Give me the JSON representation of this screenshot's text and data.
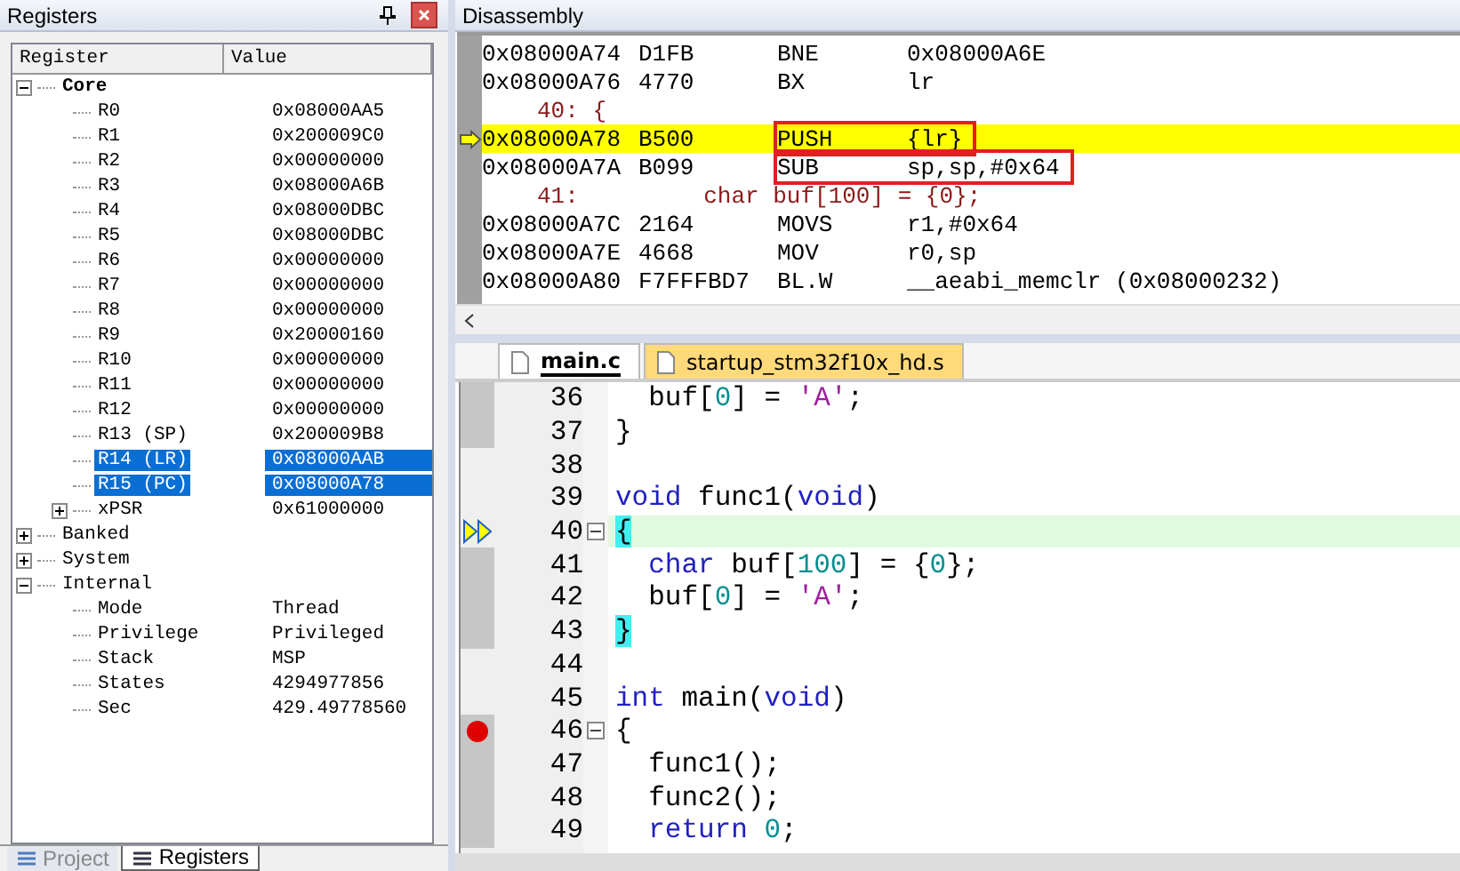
{
  "registers": {
    "title": "Registers",
    "columns": [
      "Register",
      "Value"
    ],
    "tree": [
      {
        "name": "Core",
        "bold": true,
        "expanded": true,
        "selected": false,
        "children": [
          {
            "name": "R0",
            "value": "0x08000AA5",
            "selected": false
          },
          {
            "name": "R1",
            "value": "0x200009C0",
            "selected": false
          },
          {
            "name": "R2",
            "value": "0x00000000",
            "selected": false
          },
          {
            "name": "R3",
            "value": "0x08000A6B",
            "selected": false
          },
          {
            "name": "R4",
            "value": "0x08000DBC",
            "selected": false
          },
          {
            "name": "R5",
            "value": "0x08000DBC",
            "selected": false
          },
          {
            "name": "R6",
            "value": "0x00000000",
            "selected": false
          },
          {
            "name": "R7",
            "value": "0x00000000",
            "selected": false
          },
          {
            "name": "R8",
            "value": "0x00000000",
            "selected": false
          },
          {
            "name": "R9",
            "value": "0x20000160",
            "selected": false
          },
          {
            "name": "R10",
            "value": "0x00000000",
            "selected": false
          },
          {
            "name": "R11",
            "value": "0x00000000",
            "selected": false
          },
          {
            "name": "R12",
            "value": "0x00000000",
            "selected": false
          },
          {
            "name": "R13 (SP)",
            "value": "0x200009B8",
            "selected": false
          },
          {
            "name": "R14 (LR)",
            "value": "0x08000AAB",
            "selected": true
          },
          {
            "name": "R15 (PC)",
            "value": "0x08000A78",
            "selected": true
          },
          {
            "name": "xPSR",
            "value": "0x61000000",
            "selected": false,
            "expanded": false
          }
        ]
      },
      {
        "name": "Banked",
        "bold": false,
        "expanded": false,
        "selected": false
      },
      {
        "name": "System",
        "bold": false,
        "expanded": false,
        "selected": false
      },
      {
        "name": "Internal",
        "bold": false,
        "expanded": true,
        "selected": false,
        "children": [
          {
            "name": "Mode",
            "value": "Thread",
            "selected": false
          },
          {
            "name": "Privilege",
            "value": "Privileged",
            "selected": false
          },
          {
            "name": "Stack",
            "value": "MSP",
            "selected": false
          },
          {
            "name": "States",
            "value": "4294977856",
            "selected": false
          },
          {
            "name": "Sec",
            "value": "429.49778560",
            "selected": false
          }
        ]
      }
    ],
    "bottom_tabs": [
      {
        "label": "Project",
        "selected": false
      },
      {
        "label": "Registers",
        "selected": true
      }
    ]
  },
  "disassembly": {
    "title": "Disassembly",
    "lines": [
      {
        "kind": "instr",
        "address": "0x08000A74",
        "opcode": "D1FB",
        "mnemonic": "BNE",
        "operands": "0x08000A6E",
        "current": false,
        "boxed": false
      },
      {
        "kind": "instr",
        "address": "0x08000A76",
        "opcode": "4770",
        "mnemonic": "BX",
        "operands": "lr",
        "current": false,
        "boxed": false
      },
      {
        "kind": "source",
        "text": "40: {"
      },
      {
        "kind": "instr",
        "address": "0x08000A78",
        "opcode": "B500",
        "mnemonic": "PUSH",
        "operands": "{lr}",
        "current": true,
        "boxed": true
      },
      {
        "kind": "instr",
        "address": "0x08000A7A",
        "opcode": "B099",
        "mnemonic": "SUB",
        "operands": "sp,sp,#0x64",
        "current": false,
        "boxed": true
      },
      {
        "kind": "source",
        "text": "41:         char buf[100] = {0};"
      },
      {
        "kind": "instr",
        "address": "0x08000A7C",
        "opcode": "2164",
        "mnemonic": "MOVS",
        "operands": "r1,#0x64",
        "current": false,
        "boxed": false
      },
      {
        "kind": "instr",
        "address": "0x08000A7E",
        "opcode": "4668",
        "mnemonic": "MOV",
        "operands": "r0,sp",
        "current": false,
        "boxed": false
      },
      {
        "kind": "instr",
        "address": "0x08000A80",
        "opcode": "F7FFFBD7",
        "mnemonic": "BL.W",
        "operands": "__aeabi_memclr (0x08000232)",
        "current": false,
        "boxed": false
      }
    ]
  },
  "editor": {
    "tabs": [
      {
        "label": "main.c",
        "selected": true
      },
      {
        "label": "startup_stm32f10x_hd.s",
        "selected": false
      }
    ],
    "lines": [
      {
        "number": "36",
        "code": true,
        "breakpoint": false,
        "fold": false,
        "current": false,
        "tokens": [
          {
            "text": "  buf[",
            "kind": "plain"
          },
          {
            "text": "0",
            "kind": "number"
          },
          {
            "text": "] = ",
            "kind": "plain"
          },
          {
            "text": "'A'",
            "kind": "char"
          },
          {
            "text": ";",
            "kind": "plain"
          }
        ]
      },
      {
        "number": "37",
        "code": true,
        "breakpoint": false,
        "fold": false,
        "current": false,
        "tokens": [
          {
            "text": "}",
            "kind": "plain"
          }
        ]
      },
      {
        "number": "38",
        "code": false,
        "breakpoint": false,
        "fold": false,
        "current": false
      },
      {
        "number": "39",
        "code": false,
        "breakpoint": false,
        "fold": false,
        "current": false,
        "tokens": [
          {
            "text": "void",
            "kind": "keyword"
          },
          {
            "text": " func1(",
            "kind": "plain"
          },
          {
            "text": "void",
            "kind": "keyword"
          },
          {
            "text": ")",
            "kind": "plain"
          }
        ]
      },
      {
        "number": "40",
        "code": false,
        "breakpoint": false,
        "fold": true,
        "current": true,
        "tokens": [
          {
            "text": "{",
            "kind": "brace"
          }
        ]
      },
      {
        "number": "41",
        "code": true,
        "breakpoint": false,
        "fold": false,
        "current": false,
        "tokens": [
          {
            "text": "  char",
            "kind": "keyword"
          },
          {
            "text": " buf[",
            "kind": "plain"
          },
          {
            "text": "100",
            "kind": "number"
          },
          {
            "text": "] = {",
            "kind": "plain"
          },
          {
            "text": "0",
            "kind": "number"
          },
          {
            "text": "};",
            "kind": "plain"
          }
        ]
      },
      {
        "number": "42",
        "code": true,
        "breakpoint": false,
        "fold": false,
        "current": false,
        "tokens": [
          {
            "text": "  buf[",
            "kind": "plain"
          },
          {
            "text": "0",
            "kind": "number"
          },
          {
            "text": "] = ",
            "kind": "plain"
          },
          {
            "text": "'A'",
            "kind": "char"
          },
          {
            "text": ";",
            "kind": "plain"
          }
        ]
      },
      {
        "number": "43",
        "code": true,
        "breakpoint": false,
        "fold": false,
        "current": false,
        "tokens": [
          {
            "text": "}",
            "kind": "brace"
          }
        ]
      },
      {
        "number": "44",
        "code": false,
        "breakpoint": false,
        "fold": false,
        "current": false
      },
      {
        "number": "45",
        "code": false,
        "breakpoint": false,
        "fold": false,
        "current": false,
        "tokens": [
          {
            "text": "int",
            "kind": "keyword"
          },
          {
            "text": " main(",
            "kind": "plain"
          },
          {
            "text": "void",
            "kind": "keyword"
          },
          {
            "text": ")",
            "kind": "plain"
          }
        ]
      },
      {
        "number": "46",
        "code": true,
        "breakpoint": true,
        "fold": true,
        "current": false,
        "tokens": [
          {
            "text": "{",
            "kind": "plain"
          }
        ]
      },
      {
        "number": "47",
        "code": true,
        "breakpoint": false,
        "fold": false,
        "current": false,
        "tokens": [
          {
            "text": "  func1();",
            "kind": "plain"
          }
        ]
      },
      {
        "number": "48",
        "code": true,
        "breakpoint": false,
        "fold": false,
        "current": false,
        "tokens": [
          {
            "text": "  func2();",
            "kind": "plain"
          }
        ]
      },
      {
        "number": "49",
        "code": true,
        "breakpoint": false,
        "fold": false,
        "current": false,
        "tokens": [
          {
            "text": "  return",
            "kind": "keyword"
          },
          {
            "text": " 0",
            "kind": "number"
          },
          {
            "text": ";",
            "kind": "plain"
          }
        ]
      }
    ]
  }
}
